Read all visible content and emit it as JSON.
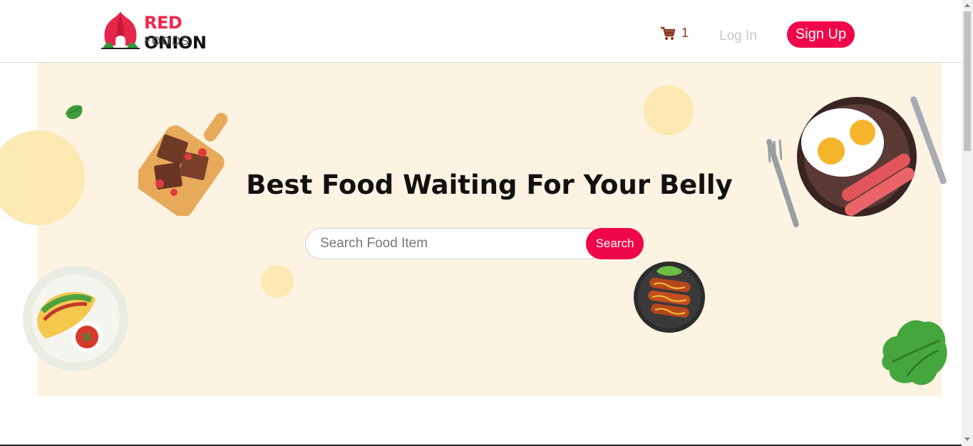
{
  "brand": {
    "name_red": "RED",
    "name_black": "ONION",
    "subtitle": "FOODS"
  },
  "nav": {
    "cart_icon": "cart-icon",
    "cart_count": "1",
    "login_label": "Log In",
    "signup_label": "Sign Up"
  },
  "hero": {
    "headline": "Best Food Waiting For Your Belly",
    "search": {
      "placeholder": "Search Food Item",
      "value": "",
      "button_label": "Search"
    }
  },
  "colors": {
    "accent": "#f0074a",
    "brand_red": "#f0274c",
    "hero_bg": "#fdf3e2",
    "cart": "#8b3a1f"
  }
}
